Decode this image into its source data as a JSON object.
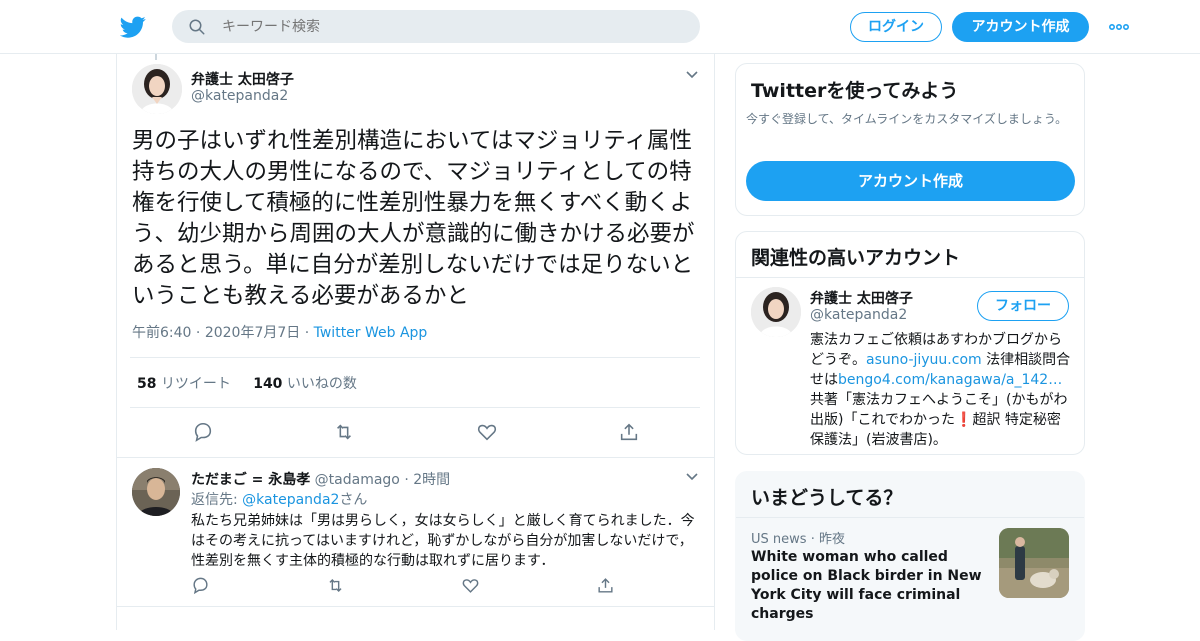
{
  "header": {
    "search_placeholder": "キーワード検索",
    "login_label": "ログイン",
    "signup_label": "アカウント作成",
    "more_icon": "more-dots-icon"
  },
  "tweet": {
    "author_name": "弁護士 太田啓子",
    "author_handle": "@katepanda2",
    "text": "男の子はいずれ性差別構造においてはマジョリティ属性持ちの大人の男性になるので、マジョリティとしての特権を行使して積極的に性差別性暴力を無くすべく動くよう、幼少期から周囲の大人が意識的に働きかける必要があると思う。単に自分が差別しないだけでは足りないということも教える必要があるかと",
    "time": "午前6:40",
    "date": "2020年7月7日",
    "sep": "·",
    "app": "Twitter Web App",
    "retweets_count": "58",
    "retweets_label": "リツイート",
    "likes_count": "140",
    "likes_label": "いいねの数"
  },
  "reply": {
    "author_name": "ただまご = 永島孝",
    "author_handle": "@tadamago",
    "sep": "·",
    "time_ago": "2時間",
    "reply_to_prefix": "返信先:",
    "reply_to_handle": "@katepanda2",
    "reply_to_suffix": "さん",
    "text": "私たち兄弟姉妹は「男は男らしく，女は女らしく」と厳しく育てられました．今はその考えに抗ってはいますけれど，恥ずかしながら自分が加害しないだけで，性差別を無くす主体的積極的な行動は取れずに居ります．"
  },
  "sidebar": {
    "signup_card": {
      "title": "Twitterを使ってみよう",
      "desc": "今すぐ登録して、タイムラインをカスタマイズしましょう。",
      "button": "アカウント作成"
    },
    "related": {
      "title": "関連性の高いアカウント",
      "name": "弁護士 太田啓子",
      "handle": "@katepanda2",
      "follow_label": "フォロー",
      "bio_1": "憲法カフェご依頼はあすわかブログからどうぞ。",
      "bio_link1": "asuno-jiyuu.com",
      "bio_2": " 法律相談問合せは",
      "bio_link2": "bengo4.com/kanagawa/a_142…",
      "bio_3": " 共著「憲法カフェへようこそ」(かもがわ出版)「これでわかった",
      "bio_excl": "❗",
      "bio_4": "超訳 特定秘密保護法」(岩波書店)。"
    },
    "trends": {
      "title": "いまどうしてる？",
      "meta_category": "US news",
      "meta_sep": "·",
      "meta_time": "昨夜",
      "headline": "White woman who called police on Black birder in New York City will face criminal charges"
    }
  },
  "colors": {
    "accent": "#1da1f2",
    "link": "#1b95e0",
    "muted": "#657786",
    "border": "#e6ecf0"
  }
}
